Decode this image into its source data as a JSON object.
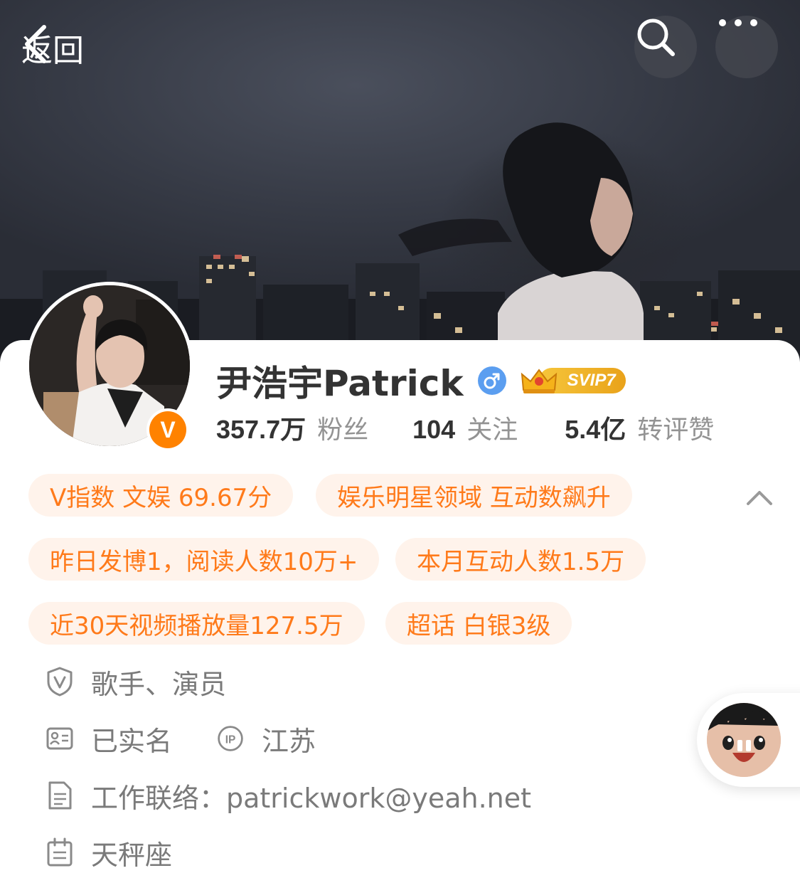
{
  "nav": {
    "back_label": "返回",
    "search_icon": "search-icon",
    "more_icon": "more-icon"
  },
  "profile": {
    "name": "尹浩宇Patrick",
    "gender": "♂",
    "verified_mark": "V",
    "svip_label": "SVIP7",
    "stats": [
      {
        "value": "357.7万",
        "label": "粉丝"
      },
      {
        "value": "104",
        "label": "关注"
      },
      {
        "value": "5.4亿",
        "label": "转评赞"
      }
    ]
  },
  "tags": [
    "V指数 文娱 69.67分",
    "娱乐明星领域 互动数飙升",
    "昨日发博1，阅读人数10万+",
    "本月互动人数1.5万",
    "近30天视频播放量127.5万",
    "超话 白银3级"
  ],
  "info": {
    "identity": "歌手、演员",
    "real_name": "已实名",
    "ip_location": "江苏",
    "contact": "工作联络：patrickwork@yeah.net",
    "zodiac": "天秤座"
  },
  "colors": {
    "accent_orange": "#ff8200",
    "tag_text": "#ff7a1a",
    "tag_bg": "#fff3eb",
    "gender_blue": "#5b9ef0"
  }
}
